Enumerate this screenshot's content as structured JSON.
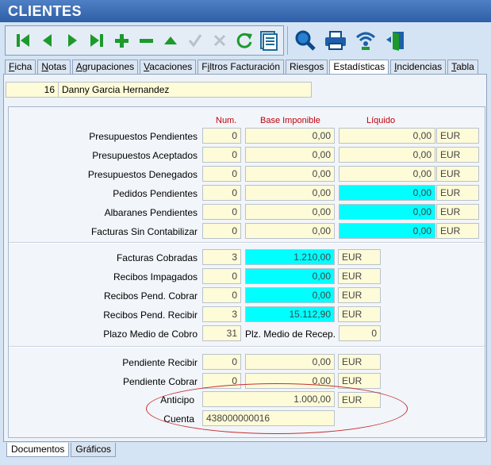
{
  "window": {
    "title": "CLIENTES"
  },
  "toolbar": {
    "left_icons": [
      "first-record",
      "prev-record",
      "next-record",
      "last-record",
      "add",
      "delete",
      "edit",
      "confirm",
      "cancel",
      "refresh",
      "list"
    ],
    "right_icons": [
      "search",
      "print",
      "wireless",
      "exit"
    ],
    "accent": "#1c9a2a"
  },
  "tabs": [
    {
      "label": "Ficha",
      "underline": "F",
      "rest": "icha"
    },
    {
      "label": "Notas",
      "underline": "N",
      "rest": "otas"
    },
    {
      "label": "Agrupaciones",
      "underline": "A",
      "rest": "grupaciones"
    },
    {
      "label": "Vacaciones",
      "underline": "V",
      "rest": "acaciones"
    },
    {
      "label": "Filtros Facturación",
      "underline": "i",
      "rest": "ltros Facturación",
      "pre": "F"
    },
    {
      "label": "Riesgos",
      "underline": "",
      "rest": "Riesgos"
    },
    {
      "label": "Estadísticas",
      "underline": "",
      "rest": "Estadísticas"
    },
    {
      "label": "Incidencias",
      "underline": "I",
      "rest": "ncidencias"
    },
    {
      "label": "Tabla",
      "underline": "T",
      "rest": "abla"
    }
  ],
  "active_tab": "Estadísticas",
  "client": {
    "id": "16",
    "name": "Danny Garcia Hernandez"
  },
  "columns": {
    "num": "Num.",
    "base": "Base Imponible",
    "liquido": "Líquido"
  },
  "section1": [
    {
      "label": "Presupuestos Pendientes",
      "num": "0",
      "base": "0,00",
      "liquido": "0,00",
      "currency": "EUR",
      "cyan": false
    },
    {
      "label": "Presupuestos Aceptados",
      "num": "0",
      "base": "0,00",
      "liquido": "0,00",
      "currency": "EUR",
      "cyan": false
    },
    {
      "label": "Presupuestos Denegados",
      "num": "0",
      "base": "0,00",
      "liquido": "0,00",
      "currency": "EUR",
      "cyan": false
    },
    {
      "label": "Pedidos Pendientes",
      "num": "0",
      "base": "0,00",
      "liquido": "0,00",
      "currency": "EUR",
      "cyan": true
    },
    {
      "label": "Albaranes Pendientes",
      "num": "0",
      "base": "0,00",
      "liquido": "0,00",
      "currency": "EUR",
      "cyan": true
    },
    {
      "label": "Facturas Sin Contabilizar",
      "num": "0",
      "base": "0,00",
      "liquido": "0,00",
      "currency": "EUR",
      "cyan": true
    }
  ],
  "section2": [
    {
      "label": "Facturas Cobradas",
      "num": "3",
      "base": "1.210,00",
      "currency": "EUR"
    },
    {
      "label": "Recibos Impagados",
      "num": "0",
      "base": "0,00",
      "currency": "EUR"
    },
    {
      "label": "Recibos Pend. Cobrar",
      "num": "0",
      "base": "0,00",
      "currency": "EUR"
    },
    {
      "label": "Recibos Pend. Recibir",
      "num": "3",
      "base": "15.112,90",
      "currency": "EUR"
    }
  ],
  "plazo": {
    "label": "Plazo  Medio de Cobro",
    "value": "31",
    "recep_label": "Plz. Medio de Recep.",
    "recep_value": "0"
  },
  "section3": [
    {
      "label": "Pendiente Recibir",
      "num": "0",
      "base": "0,00",
      "currency": "EUR"
    },
    {
      "label": "Pendiente Cobrar",
      "num": "0",
      "base": "0,00",
      "currency": "EUR"
    }
  ],
  "anticipo": {
    "label": "Anticipo",
    "value": "1.000,00",
    "currency": "EUR"
  },
  "cuenta": {
    "label": "Cuenta",
    "value": "438000000016"
  },
  "bottom_tabs": [
    "Documentos",
    "Gráficos"
  ],
  "active_bottom_tab": "Documentos"
}
